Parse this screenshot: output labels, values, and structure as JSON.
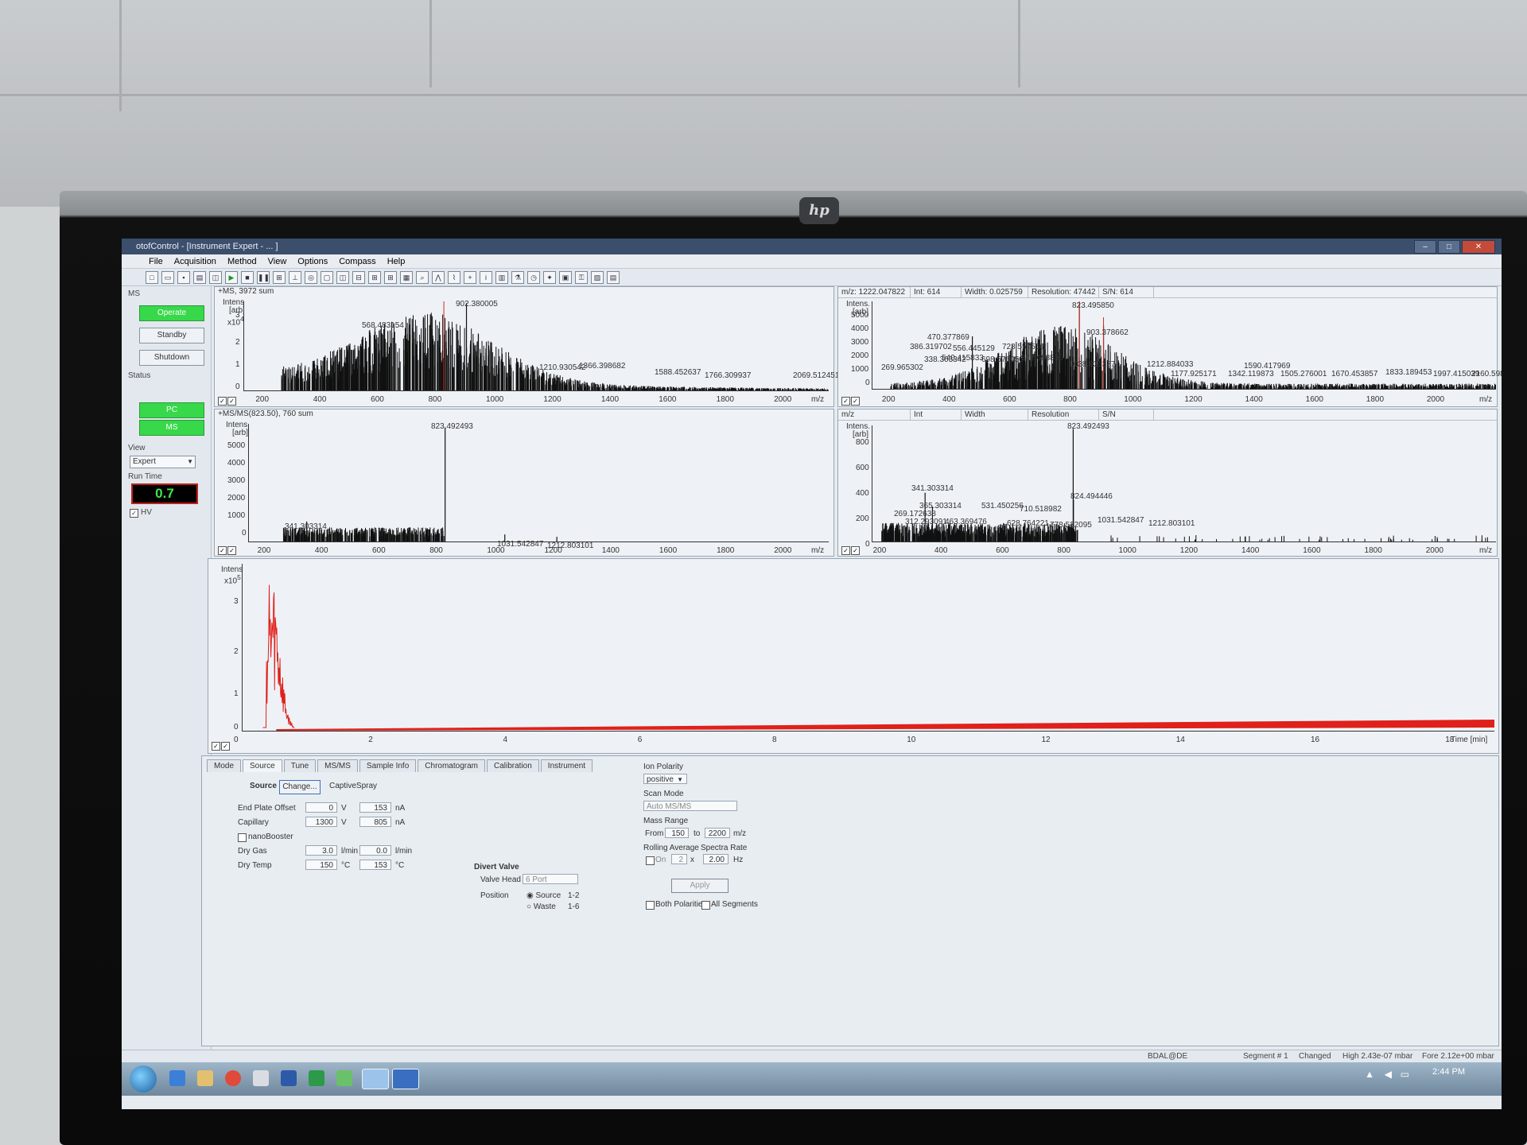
{
  "window": {
    "title": "otofControl - [Instrument Expert - ... ]"
  },
  "menu": [
    "File",
    "Acquisition",
    "Method",
    "View",
    "Options",
    "Compass",
    "Help"
  ],
  "left_panel": {
    "ms_label": "MS",
    "operate": "Operate",
    "standby": "Standby",
    "shutdown": "Shutdown",
    "status_label": "Status",
    "pc": "PC",
    "ms": "MS",
    "view_label": "View",
    "view_value": "Expert",
    "runtime_label": "Run Time",
    "runtime_value": "0.7",
    "hv_label": "HV"
  },
  "panel_tl": {
    "title": "+MS, 3972 sum",
    "intens_label": "Intens.",
    "arb_label": "[arb]",
    "scale": "x10",
    "scale_exp": "4",
    "yticks": [
      "3",
      "2",
      "1",
      "0"
    ],
    "xticks": [
      "200",
      "400",
      "600",
      "800",
      "1000",
      "1200",
      "1400",
      "1600",
      "1800",
      "2000"
    ],
    "xunit": "m/z",
    "peaks": [
      "902.380005",
      "568.483154",
      "1210.930542",
      "1366.398682",
      "1588.452637",
      "1766.309937",
      "2069.512451"
    ]
  },
  "panel_tr": {
    "info": [
      "m/z: 1222.047822",
      "Int: 614",
      "Width: 0.025759",
      "Resolution: 47442",
      "S/N: 614"
    ],
    "intens_label": "Intens.",
    "arb_label": "[arb]",
    "yticks": [
      "5000",
      "4000",
      "3000",
      "2000",
      "1000",
      "0"
    ],
    "xticks": [
      "200",
      "400",
      "600",
      "800",
      "1000",
      "1200",
      "1400",
      "1600",
      "1800",
      "2000"
    ],
    "xunit": "m/z",
    "peaks": [
      "823.495850",
      "903.378662",
      "470.377869",
      "386.319702",
      "556.445129",
      "728.557556",
      "338.303342",
      "540.415833",
      "698.576050",
      "852.698850",
      "269.965302",
      "1038.835327",
      "1212.884033",
      "1590.417969",
      "1177.925171",
      "1342.119873",
      "1505.276001",
      "1670.453857",
      "1833.189453",
      "1997.415039",
      "2160.5983"
    ]
  },
  "panel_ml": {
    "title": "+MS/MS(823.50), 760 sum",
    "intens_label": "Intens.",
    "arb_label": "[arb]",
    "yticks": [
      "5000",
      "4000",
      "3000",
      "2000",
      "1000",
      "0"
    ],
    "xticks": [
      "200",
      "400",
      "600",
      "800",
      "1000",
      "1200",
      "1400",
      "1600",
      "1800",
      "2000"
    ],
    "xunit": "m/z",
    "peaks": [
      "823.492493",
      "341.303314",
      "1031.542847",
      "1212.803101"
    ]
  },
  "panel_mr": {
    "info": [
      "m/z",
      "Int",
      "Width",
      "Resolution",
      "S/N"
    ],
    "intens_label": "Intens.",
    "arb_label": "[arb]",
    "yticks": [
      "800",
      "600",
      "400",
      "200",
      "0"
    ],
    "xticks": [
      "200",
      "400",
      "600",
      "800",
      "1000",
      "1200",
      "1400",
      "1600",
      "1800",
      "2000"
    ],
    "xunit": "m/z",
    "peaks": [
      "823.492493",
      "341.303314",
      "365.303314",
      "269.172638",
      "312.293091",
      "463.369476",
      "531.450256",
      "628.764221",
      "710.518982",
      "778.522095",
      "824.494446",
      "1031.542847",
      "1212.803101"
    ]
  },
  "chromatogram": {
    "intens_label": "Intens.",
    "scale": "x10",
    "scale_exp": "5",
    "yticks": [
      "3",
      "2",
      "1",
      "0"
    ],
    "xticks": [
      "0",
      "2",
      "4",
      "6",
      "8",
      "10",
      "12",
      "14",
      "16",
      "18"
    ],
    "xunit": "Time [min]"
  },
  "tabs": [
    "Mode",
    "Source",
    "Tune",
    "MS/MS",
    "Sample Info",
    "Chromatogram",
    "Calibration",
    "Instrument"
  ],
  "source": {
    "source_label": "Source",
    "change_button": "Change...",
    "source_name": "CaptiveSpray",
    "end_plate_label": "End Plate Offset",
    "end_plate_set": "0",
    "end_plate_unit": "V",
    "end_plate_read": "153",
    "end_plate_read_unit": "nA",
    "capillary_label": "Capillary",
    "capillary_set": "1300",
    "capillary_unit": "V",
    "capillary_read": "805",
    "capillary_read_unit": "nA",
    "nanobooster_label": "nanoBooster",
    "dry_gas_label": "Dry Gas",
    "dry_gas_set": "3.0",
    "dry_gas_unit": "l/min",
    "dry_gas_read": "0.0",
    "dry_gas_read_unit": "l/min",
    "dry_temp_label": "Dry Temp",
    "dry_temp_set": "150",
    "dry_temp_unit": "°C",
    "dry_temp_read": "153",
    "dry_temp_read_unit": "°C"
  },
  "divert": {
    "title": "Divert Valve",
    "valve_head_label": "Valve Head",
    "valve_head_value": "6 Port",
    "position_label": "Position",
    "source_option": "Source",
    "source_ports": "1-2",
    "waste_option": "Waste",
    "waste_ports": "1-6"
  },
  "right_controls": {
    "ion_polarity_label": "Ion Polarity",
    "ion_polarity_value": "positive",
    "scan_mode_label": "Scan Mode",
    "scan_mode_value": "Auto MS/MS",
    "mass_range_label": "Mass Range",
    "from_label": "From",
    "from_value": "150",
    "to_label": "to",
    "to_value": "2200",
    "mass_unit": "m/z",
    "rolling_avg_label": "Rolling Average",
    "on_label": "On",
    "rolling_value": "2",
    "x_label": "x",
    "spectra_rate_label": "Spectra Rate",
    "spectra_rate_value": "2.00",
    "hz_label": "Hz",
    "apply_button": "Apply",
    "both_polarities": "Both Polarities",
    "all_segments": "All Segments"
  },
  "statusbar": {
    "user": "BDAL@DE",
    "segment": "Segment # 1",
    "changed": "Changed",
    "high": "High 2.43e-07 mbar",
    "fore": "Fore 2.12e+00 mbar"
  },
  "taskbar": {
    "clock": "2:44 PM"
  },
  "monitor": {
    "brand": "hp"
  },
  "colors": {
    "operate_green": "#37d84a",
    "runtime_text": "#3fe84a",
    "trace_red": "#e0201a",
    "titlebar": "#3b4e6b"
  }
}
